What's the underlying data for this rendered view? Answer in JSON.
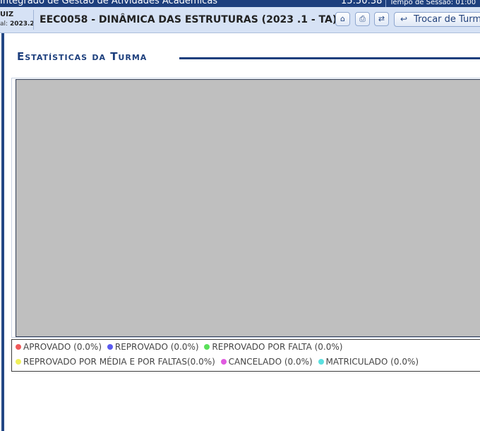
{
  "topbar": {
    "system_title": "Integrado de Gestão de Atividades Acadêmicas",
    "clock": "15:50:38",
    "session_label": "Tempo de Sessão: 01:00"
  },
  "header": {
    "user_name": "UIZ",
    "semester_label": "al:",
    "semester_value": "2023.2",
    "course_title": "EEC0058 - DINÂMICA DAS ESTRUTURAS (2023 .1 - TA)",
    "buttons": {
      "home_icon": "home-icon",
      "print_icon": "print-icon",
      "switch_icon": "switch-icon",
      "trocar_label": "Trocar de Turma",
      "trocar_icon": "back-arrow-icon"
    }
  },
  "section": {
    "title": "Estatísticas da Turma"
  },
  "chart_data": {
    "type": "pie",
    "categories": [
      "APROVADO",
      "REPROVADO",
      "REPROVADO POR FALTA",
      "REPROVADO POR MÉDIA E POR FALTAS",
      "CANCELADO",
      "MATRICULADO"
    ],
    "values": [
      0.0,
      0.0,
      0.0,
      0.0,
      0.0,
      0.0
    ],
    "colors": [
      "#f05a5a",
      "#5a5af0",
      "#5ae05a",
      "#f0f05a",
      "#e05ae0",
      "#5ae0e0"
    ],
    "background": "#bfbfbf"
  },
  "legend": {
    "items": [
      {
        "text": "APROVADO (0.0%)",
        "color": "#f05a5a"
      },
      {
        "text": "REPROVADO (0.0%)",
        "color": "#5a5af0"
      },
      {
        "text": "REPROVADO POR FALTA (0.0%)",
        "color": "#5ae05a"
      },
      {
        "text": "REPROVADO POR MÉDIA E POR FALTAS(0.0%)",
        "color": "#f0f05a"
      },
      {
        "text": "CANCELADO (0.0%)",
        "color": "#e05ae0"
      },
      {
        "text": "MATRICULADO (0.0%)",
        "color": "#5ae0e0"
      }
    ]
  }
}
